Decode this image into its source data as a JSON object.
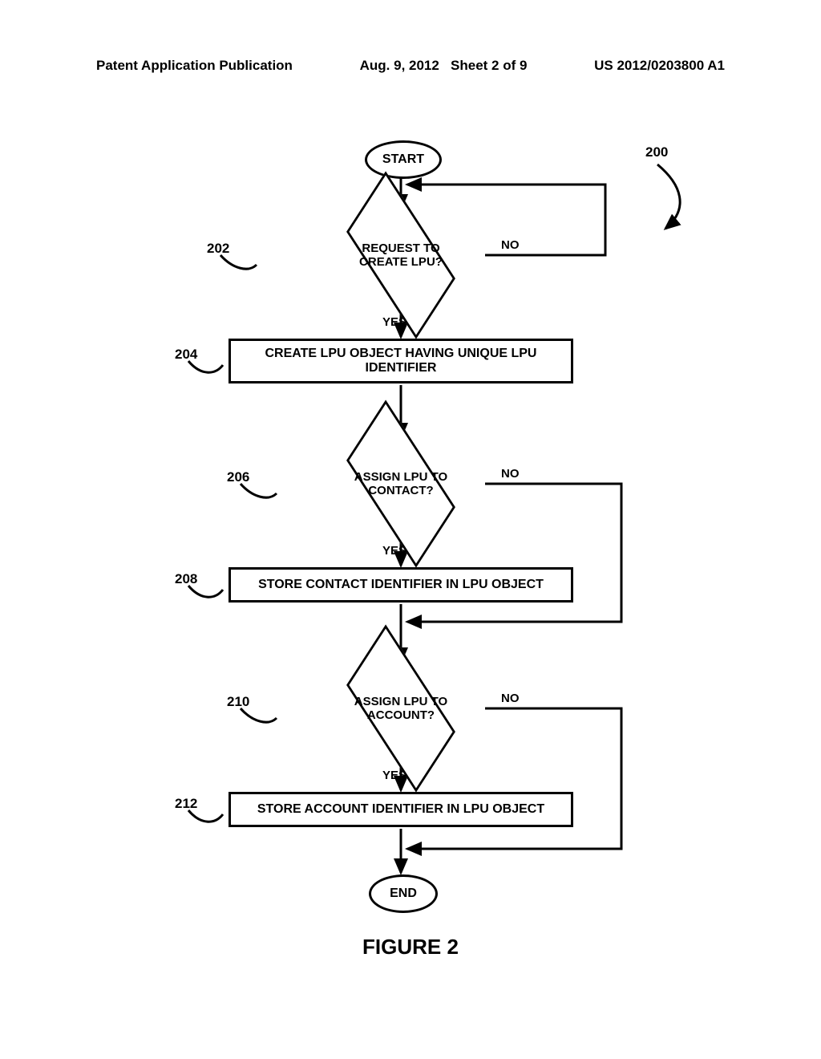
{
  "header": {
    "publication": "Patent Application Publication",
    "date": "Aug. 9, 2012",
    "sheet": "Sheet 2 of 9",
    "docnum": "US 2012/0203800 A1"
  },
  "nodes": {
    "start": "START",
    "d202": "REQUEST TO CREATE LPU?",
    "p204": "CREATE LPU OBJECT HAVING UNIQUE LPU IDENTIFIER",
    "d206": "ASSIGN LPU TO CONTACT?",
    "p208": "STORE CONTACT IDENTIFIER IN LPU OBJECT",
    "d210": "ASSIGN LPU TO ACCOUNT?",
    "p212": "STORE ACCOUNT IDENTIFIER IN LPU OBJECT",
    "end": "END"
  },
  "labels": {
    "yes": "YES",
    "no": "NO"
  },
  "refs": {
    "r200": "200",
    "r202": "202",
    "r204": "204",
    "r206": "206",
    "r208": "208",
    "r210": "210",
    "r212": "212"
  },
  "figure_caption": "FIGURE 2"
}
